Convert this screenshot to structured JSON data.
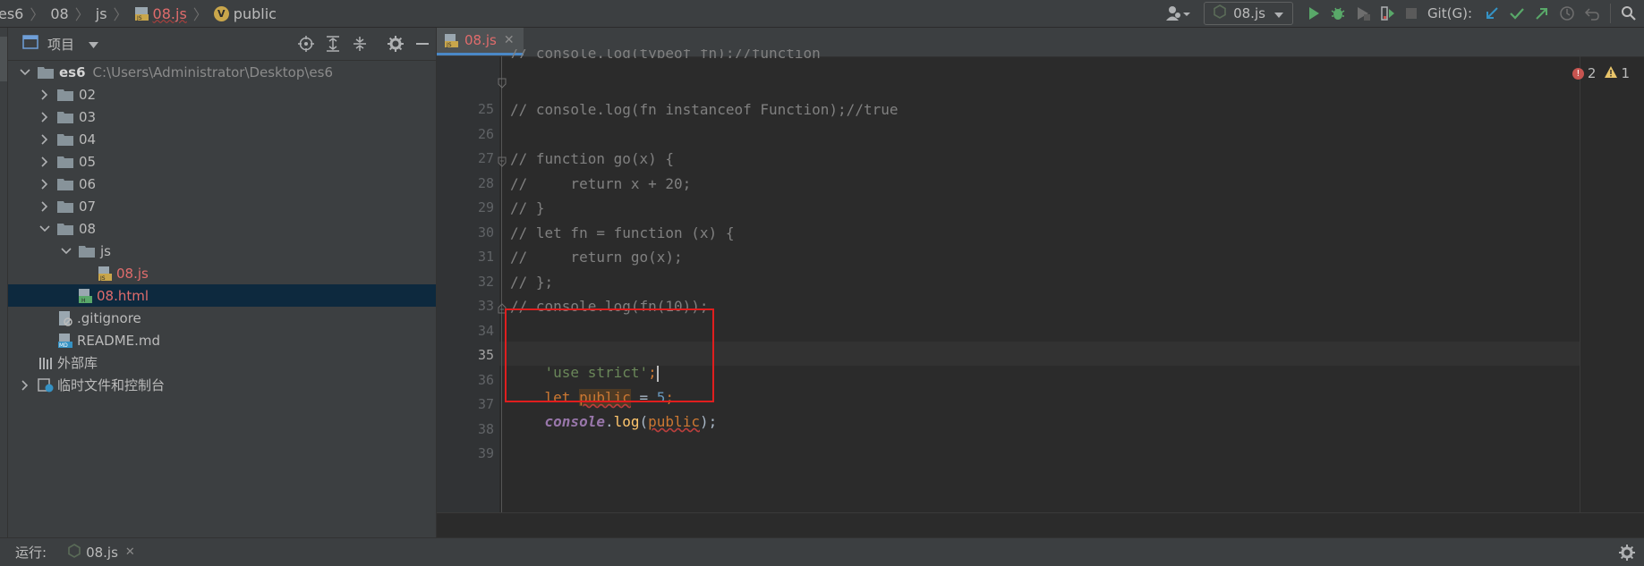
{
  "navbar": {
    "crumbs": [
      "es6",
      "08",
      "js",
      "08.js",
      "public"
    ],
    "run_config": "08.js",
    "git_label": "Git(G):"
  },
  "project_panel": {
    "title": "项目",
    "root": {
      "name": "es6",
      "path": "C:\\Users\\Administrator\\Desktop\\es6"
    },
    "folders": [
      "02",
      "03",
      "04",
      "05",
      "06",
      "07",
      "08"
    ],
    "subfolder": "js",
    "js_file": "08.js",
    "html_file": "08.html",
    "gitignore": ".gitignore",
    "readme": "README.md",
    "external_libs": "外部库",
    "scratches": "临时文件和控制台"
  },
  "editor": {
    "tab_label": "08.js",
    "inspections": {
      "errors": "2",
      "warnings": "1"
    },
    "partial_top_line": "// console.log(typeof fn);//function",
    "lines": [
      {
        "num": "25",
        "text": "// console.log(fn instanceof Function);//true"
      },
      {
        "num": "26",
        "text": ""
      },
      {
        "num": "27",
        "text": "// function go(x) {"
      },
      {
        "num": "28",
        "text": "//     return x + 20;"
      },
      {
        "num": "29",
        "text": "// }"
      },
      {
        "num": "30",
        "text": "// let fn = function (x) {"
      },
      {
        "num": "31",
        "text": "//     return go(x);"
      },
      {
        "num": "32",
        "text": "// };"
      },
      {
        "num": "33",
        "text": "// console.log(fn(10));"
      },
      {
        "num": "34",
        "text": ""
      },
      {
        "num": "35",
        "text": ""
      },
      {
        "num": "36",
        "text": ""
      },
      {
        "num": "37",
        "text": ""
      },
      {
        "num": "38",
        "text": ""
      },
      {
        "num": "39",
        "text": ""
      }
    ],
    "code": {
      "l35_str": "'use strict'",
      "l35_semi": ";",
      "l36_let": "let",
      "l36_var": "public",
      "l36_eq": " = ",
      "l36_num": "5",
      "l36_semi": ";",
      "l37_obj": "console",
      "l37_dot": ".",
      "l37_fn": "log",
      "l37_open": "(",
      "l37_arg": "public",
      "l37_close": ");"
    }
  },
  "run_bar": {
    "label": "运行:",
    "tab": "08.js"
  },
  "colors": {
    "accent_blue": "#4a88c7",
    "error_red": "#e01e1e",
    "run_green": "#59a869"
  }
}
